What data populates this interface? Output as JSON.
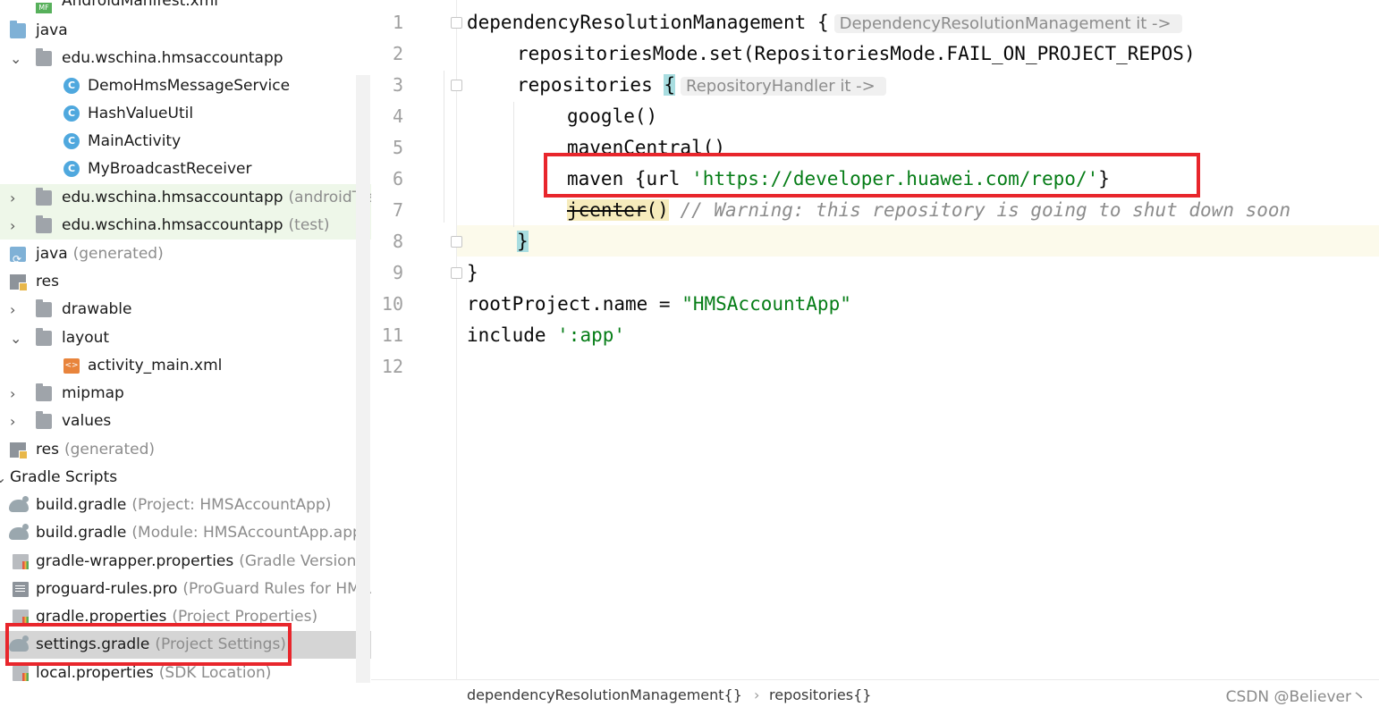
{
  "tree": {
    "rows": [
      {
        "label": "AndroidManifest.xml",
        "suffix": ""
      },
      {
        "label": "java",
        "suffix": ""
      },
      {
        "label": "edu.wschina.hmsaccountapp",
        "suffix": ""
      },
      {
        "label": "DemoHmsMessageService",
        "suffix": ""
      },
      {
        "label": "HashValueUtil",
        "suffix": ""
      },
      {
        "label": "MainActivity",
        "suffix": ""
      },
      {
        "label": "MyBroadcastReceiver",
        "suffix": ""
      },
      {
        "label": "edu.wschina.hmsaccountapp",
        "suffix": "(androidTest)"
      },
      {
        "label": "edu.wschina.hmsaccountapp",
        "suffix": "(test)"
      },
      {
        "label": "java",
        "suffix": "(generated)"
      },
      {
        "label": "res",
        "suffix": ""
      },
      {
        "label": "drawable",
        "suffix": ""
      },
      {
        "label": "layout",
        "suffix": ""
      },
      {
        "label": "activity_main.xml",
        "suffix": ""
      },
      {
        "label": "mipmap",
        "suffix": ""
      },
      {
        "label": "values",
        "suffix": ""
      },
      {
        "label": "res",
        "suffix": "(generated)"
      },
      {
        "label": "Gradle Scripts",
        "suffix": ""
      },
      {
        "label": "build.gradle",
        "suffix": "(Project: HMSAccountApp)"
      },
      {
        "label": "build.gradle",
        "suffix": "(Module: HMSAccountApp.app)"
      },
      {
        "label": "gradle-wrapper.properties",
        "suffix": "(Gradle Version)"
      },
      {
        "label": "proguard-rules.pro",
        "suffix": "(ProGuard Rules for HMSA"
      },
      {
        "label": "gradle.properties",
        "suffix": "(Project Properties)"
      },
      {
        "label": "settings.gradle",
        "suffix": "(Project Settings)"
      },
      {
        "label": "local.properties",
        "suffix": "(SDK Location)"
      }
    ],
    "manifest_badge": "MF",
    "class_badge": "C",
    "xml_badge": "<>"
  },
  "editor": {
    "line_numbers": [
      "1",
      "2",
      "3",
      "4",
      "5",
      "6",
      "7",
      "8",
      "9",
      "10",
      "11",
      "12"
    ],
    "lines": {
      "l1_code": "dependencyResolutionManagement ",
      "l1_brace": "{",
      "l1_hint": "DependencyResolutionManagement it ->",
      "l2_code": "repositoriesMode.set(RepositoriesMode.FAIL_ON_PROJECT_REPOS)",
      "l3_code": "repositories ",
      "l3_brace": "{",
      "l3_hint": "RepositoryHandler it ->",
      "l4_code": "google()",
      "l5_code": "mavenCentral()",
      "l6_pre": "maven {url ",
      "l6_str": "'https://developer.huawei.com/repo/'",
      "l6_post": "}",
      "l7_dep": "jcenter",
      "l7_paren": "()",
      "l7_comment": " // Warning: this repository is going to shut down soon",
      "l8_brace": "}",
      "l9_brace": "}",
      "l10_pre": "rootProject.name = ",
      "l10_str": "\"HMSAccountApp\"",
      "l11_pre": "include ",
      "l11_str": "':app'"
    },
    "breadcrumb": {
      "items": [
        "dependencyResolutionManagement{}",
        "repositories{}"
      ],
      "separator": "›"
    },
    "watermark": "CSDN @Believer丶"
  },
  "colors": {
    "string": "#067d17",
    "highlight_box": "#e8262c",
    "brace_match": "#a8dde0",
    "current_line": "#fcfaeb"
  }
}
